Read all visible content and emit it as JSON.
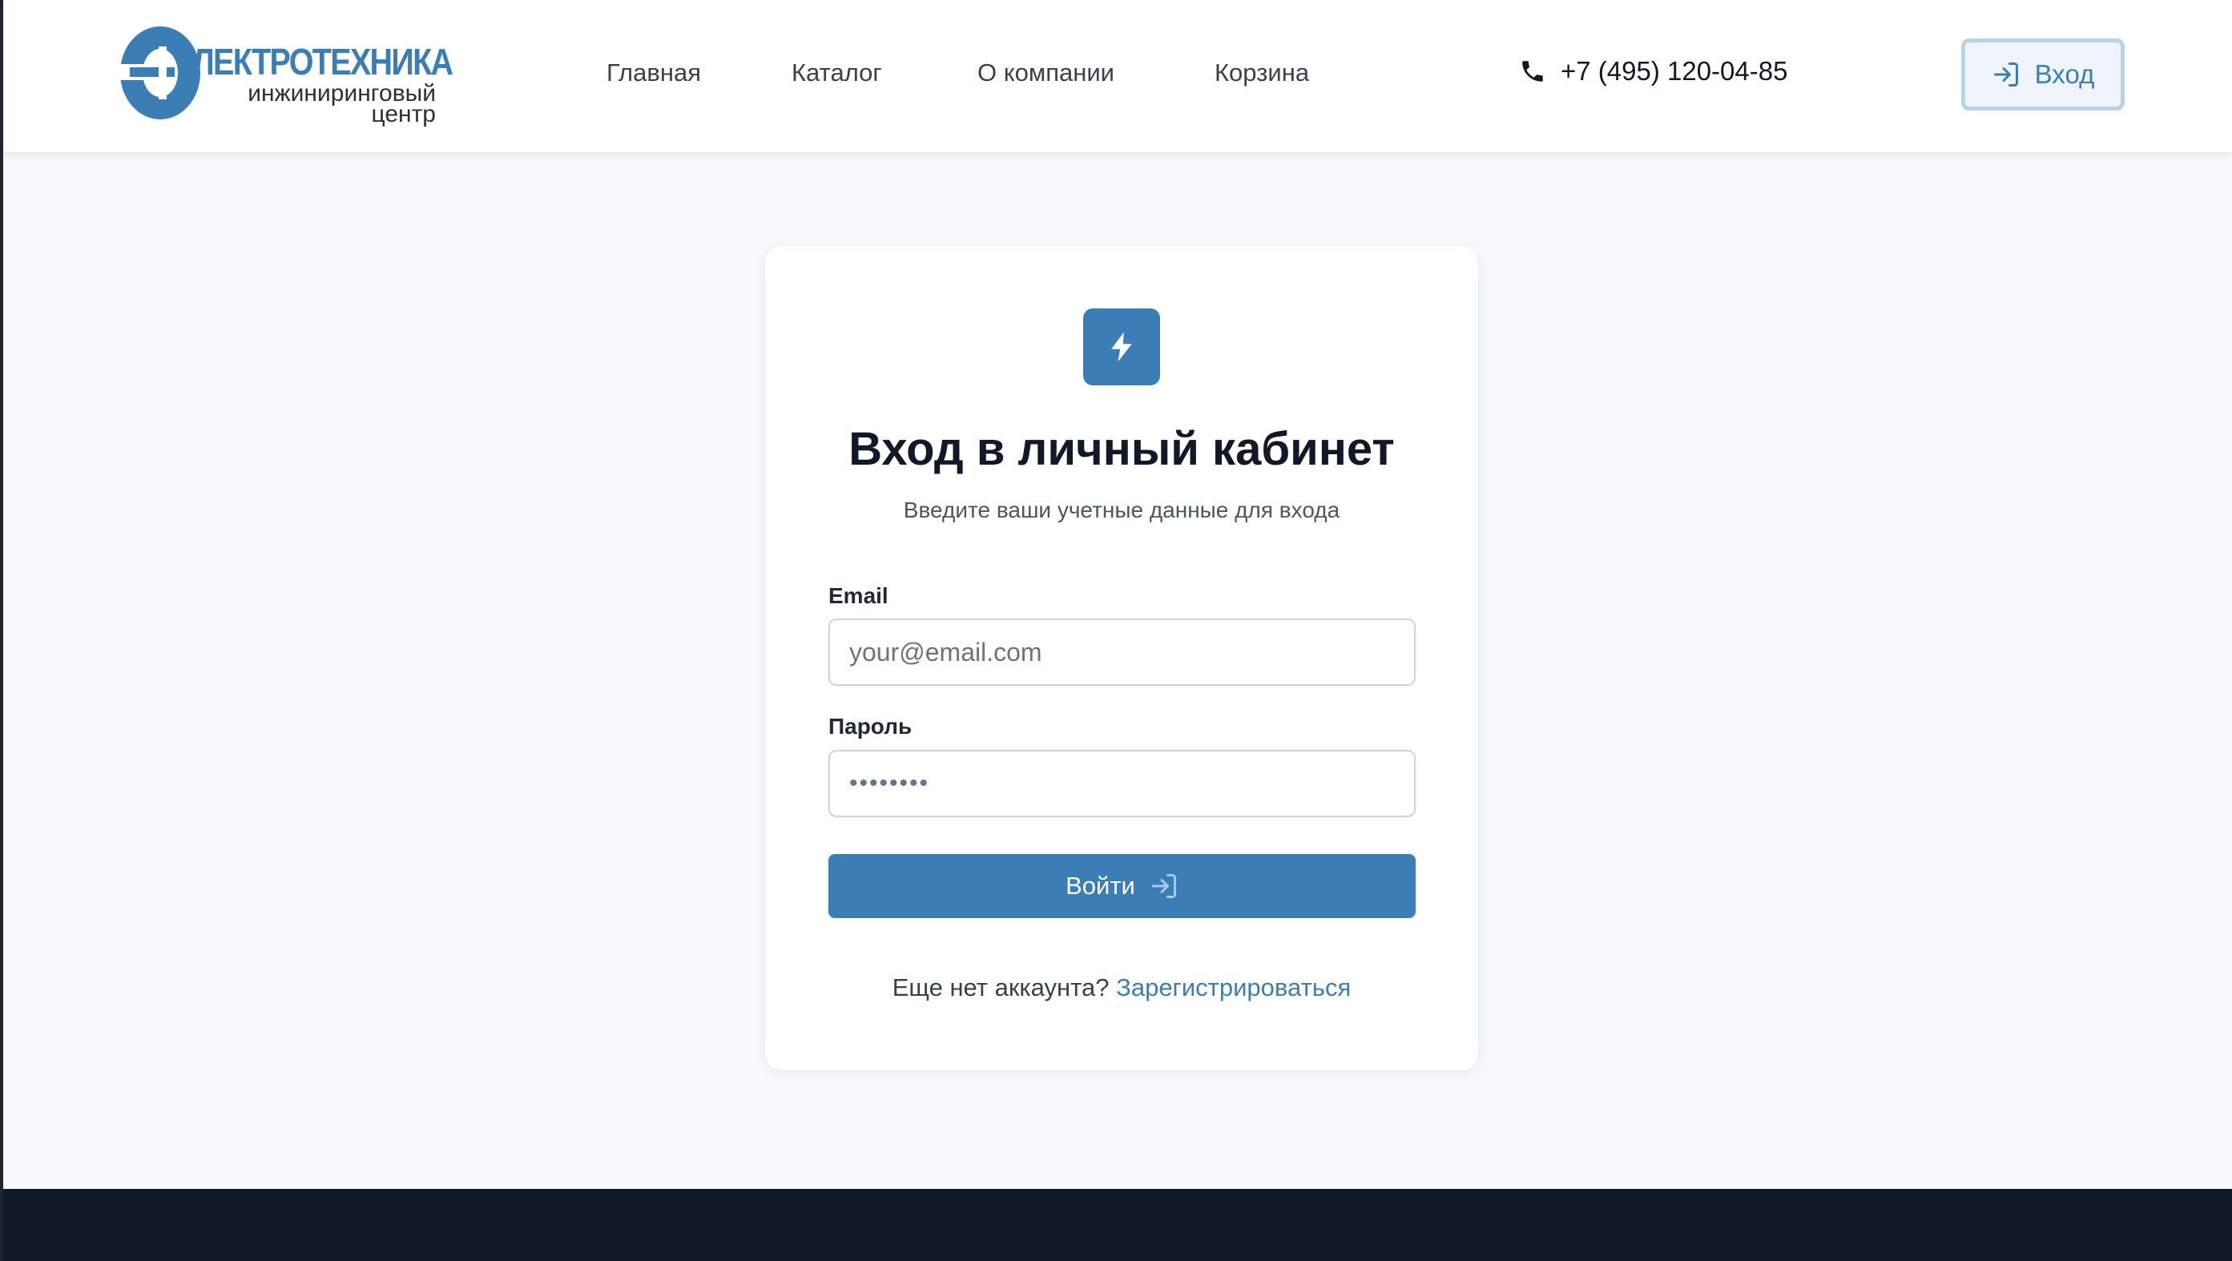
{
  "header": {
    "logo": {
      "title": "ЛЕКТРОТЕХНИКА",
      "subtitle_line1": "инжиниринговый",
      "subtitle_line2": "центр",
      "brand_color": "#3b7db5"
    },
    "nav": [
      {
        "label": "Главная"
      },
      {
        "label": "Каталог"
      },
      {
        "label": "О компании"
      },
      {
        "label": "Корзина"
      }
    ],
    "phone": {
      "icon": "phone-icon",
      "number": "+7 (495) 120-04-85"
    },
    "login_button": {
      "icon": "login-icon",
      "label": "Вход"
    }
  },
  "login_card": {
    "icon": "lightning-icon",
    "title": "Вход в личный кабинет",
    "subtitle": "Введите ваши учетные данные для входа",
    "email": {
      "label": "Email",
      "placeholder": "your@email.com",
      "value": ""
    },
    "password": {
      "label": "Пароль",
      "placeholder": "••••••••",
      "value": ""
    },
    "submit": {
      "label": "Войти",
      "icon": "login-icon"
    },
    "register": {
      "prompt": "Еще нет аккаунта?",
      "link": "Зарегистрироваться"
    }
  },
  "colors": {
    "accent": "#3b7db5",
    "background": "#f8f9fb",
    "footer": "#121827",
    "text_dark": "#111827"
  }
}
